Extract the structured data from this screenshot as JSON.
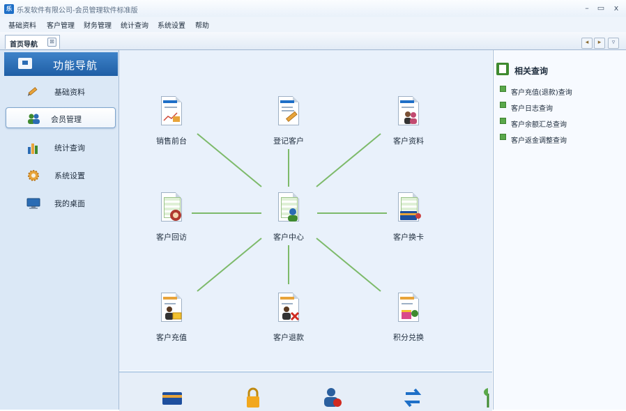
{
  "window": {
    "title": "乐发软件有限公司-会员管理软件标准版",
    "logo_text": "乐",
    "minimize": "–",
    "maximize": "▭",
    "close": "x"
  },
  "menu": [
    "基础资料",
    "客户管理",
    "财务管理",
    "统计查询",
    "系统设置",
    "帮助"
  ],
  "tab": {
    "label": "首页导航",
    "close": "⊠"
  },
  "sidebar": {
    "header": "功能导航",
    "items": [
      {
        "label": "基础资料",
        "icon": "pencil-icon",
        "active": false
      },
      {
        "label": "会员管理",
        "icon": "users-icon",
        "active": true
      },
      {
        "label": "统计查询",
        "icon": "bar-chart-icon",
        "active": false
      },
      {
        "label": "系统设置",
        "icon": "gear-icon",
        "active": false
      },
      {
        "label": "我的桌面",
        "icon": "monitor-icon",
        "active": false
      }
    ]
  },
  "hub": {
    "center": "客户中心",
    "nodes": [
      {
        "label": "销售前台",
        "icon": "sales-doc-icon"
      },
      {
        "label": "登记客户",
        "icon": "register-doc-icon"
      },
      {
        "label": "客户资料",
        "icon": "customer-profile-icon"
      },
      {
        "label": "客户回访",
        "icon": "phone-visit-icon"
      },
      {
        "label": "客户换卡",
        "icon": "card-swap-icon"
      },
      {
        "label": "客户充值",
        "icon": "recharge-icon"
      },
      {
        "label": "客户退款",
        "icon": "refund-icon"
      },
      {
        "label": "积分兑换",
        "icon": "points-exchange-icon"
      }
    ]
  },
  "bottom_icons": [
    "card-icon",
    "lock-icon",
    "user-alert-icon",
    "refresh-arrows-icon",
    "plant-icon"
  ],
  "related": {
    "title": "相关查询",
    "links": [
      "客户充值(退款)查询",
      "客户日志查询",
      "客户余额汇总查询",
      "客户返金调整查询"
    ]
  },
  "colors": {
    "accent": "#1f5ea5",
    "connector": "#7dba6a",
    "sidebar_bg": "#dbe8f6",
    "main_bg": "#e9f1fb"
  }
}
